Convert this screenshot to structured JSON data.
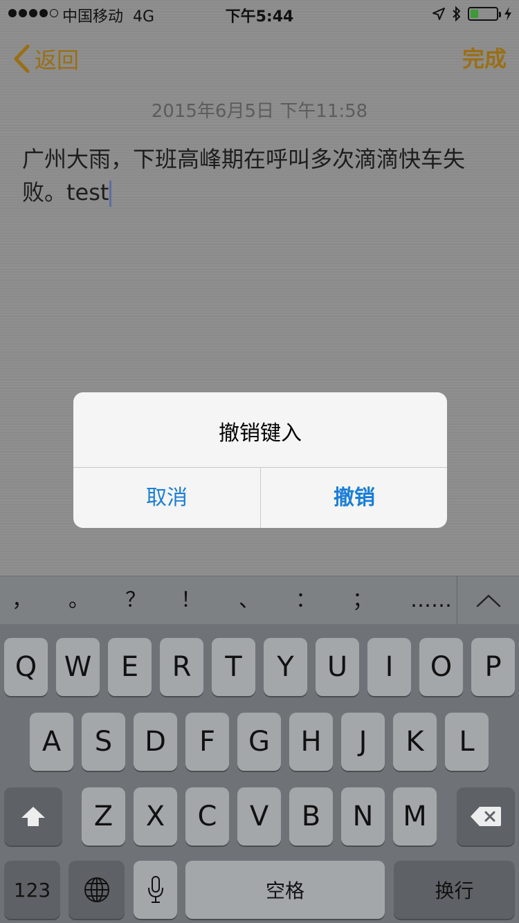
{
  "status_bar": {
    "carrier": "中国移动",
    "network": "4G",
    "time": "下午5:44",
    "signal_bars_filled": 4,
    "signal_bars_total": 5,
    "battery_level": 0.3
  },
  "nav": {
    "back_label": "返回",
    "done_label": "完成",
    "accent_color": "#9a6f15"
  },
  "note": {
    "date": "2015年6月5日 下午11:58",
    "body": "广州大雨，下班高峰期在呼叫多次滴滴快车失败。test"
  },
  "alert": {
    "title": "撤销键入",
    "cancel_label": "取消",
    "undo_label": "撤销",
    "button_color": "#1a7ed8"
  },
  "keyboard": {
    "punctuation": [
      "，",
      "。",
      "？",
      "！",
      "、",
      "：",
      "；",
      "……"
    ],
    "row1": [
      "Q",
      "W",
      "E",
      "R",
      "T",
      "Y",
      "U",
      "I",
      "O",
      "P"
    ],
    "row2": [
      "A",
      "S",
      "D",
      "F",
      "G",
      "H",
      "J",
      "K",
      "L"
    ],
    "row3": [
      "Z",
      "X",
      "C",
      "V",
      "B",
      "N",
      "M"
    ],
    "numbers_label": "123",
    "space_label": "空格",
    "return_label": "换行",
    "icons": {
      "shift": "shift-icon",
      "delete": "delete-icon",
      "globe": "globe-icon",
      "mic": "microphone-icon",
      "collapse": "chevron-up-icon"
    }
  }
}
